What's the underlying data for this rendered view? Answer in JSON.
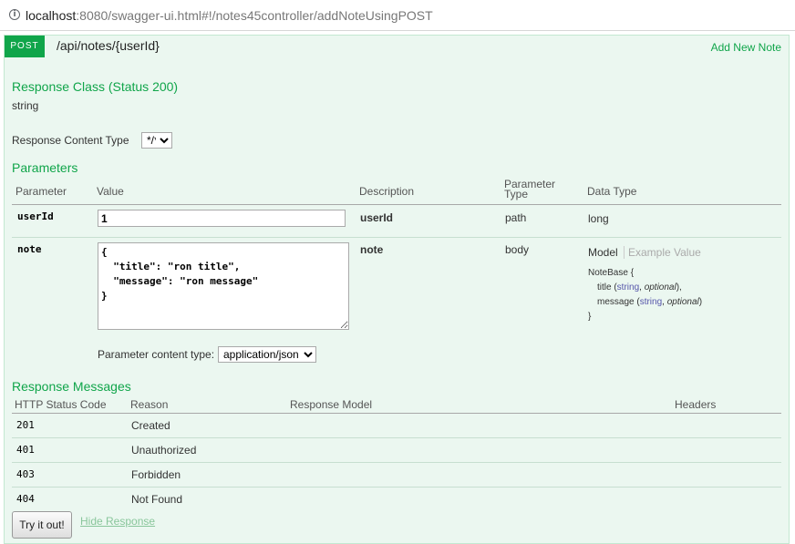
{
  "browser": {
    "url_host": "localhost",
    "url_rest": ":8080/swagger-ui.html#!/notes45controller/addNoteUsingPOST"
  },
  "operation": {
    "method": "POST",
    "path": "/api/notes/{userId}",
    "summary": "Add New Note"
  },
  "response_class": {
    "heading": "Response Class (Status 200)",
    "type": "string"
  },
  "response_content_type": {
    "label": "Response Content Type",
    "selected": "*/*"
  },
  "parameters": {
    "heading": "Parameters",
    "headers": {
      "parameter": "Parameter",
      "value": "Value",
      "description": "Description",
      "parameter_type_1": "Parameter",
      "parameter_type_2": "Type",
      "data_type": "Data Type"
    },
    "rows": [
      {
        "name": "userId",
        "value": "1",
        "description": "userId",
        "param_type": "path",
        "data_type": "long"
      },
      {
        "name": "note",
        "value": "{\n  \"title\": \"ron title\",\n  \"message\": \"ron message\"\n}",
        "description": "note",
        "param_type": "body",
        "model_tab": "Model",
        "example_tab": "Example Value",
        "model_name": "NoteBase {",
        "field_title": "title",
        "field_message": "message",
        "field_type": "string",
        "field_optional": "optional",
        "model_close": "}"
      }
    ],
    "content_type": {
      "label": "Parameter content type:",
      "selected": "application/json"
    }
  },
  "response_messages": {
    "heading": "Response Messages",
    "headers": {
      "code": "HTTP Status Code",
      "reason": "Reason",
      "model": "Response Model",
      "headers": "Headers"
    },
    "rows": [
      {
        "code": "201",
        "reason": "Created"
      },
      {
        "code": "401",
        "reason": "Unauthorized"
      },
      {
        "code": "403",
        "reason": "Forbidden"
      },
      {
        "code": "404",
        "reason": "Not Found"
      }
    ]
  },
  "actions": {
    "try_it_out": "Try it out!",
    "hide_response": "Hide Response"
  },
  "colors": {
    "accent": "#10a54a",
    "panel_bg": "#ebf7f0"
  }
}
